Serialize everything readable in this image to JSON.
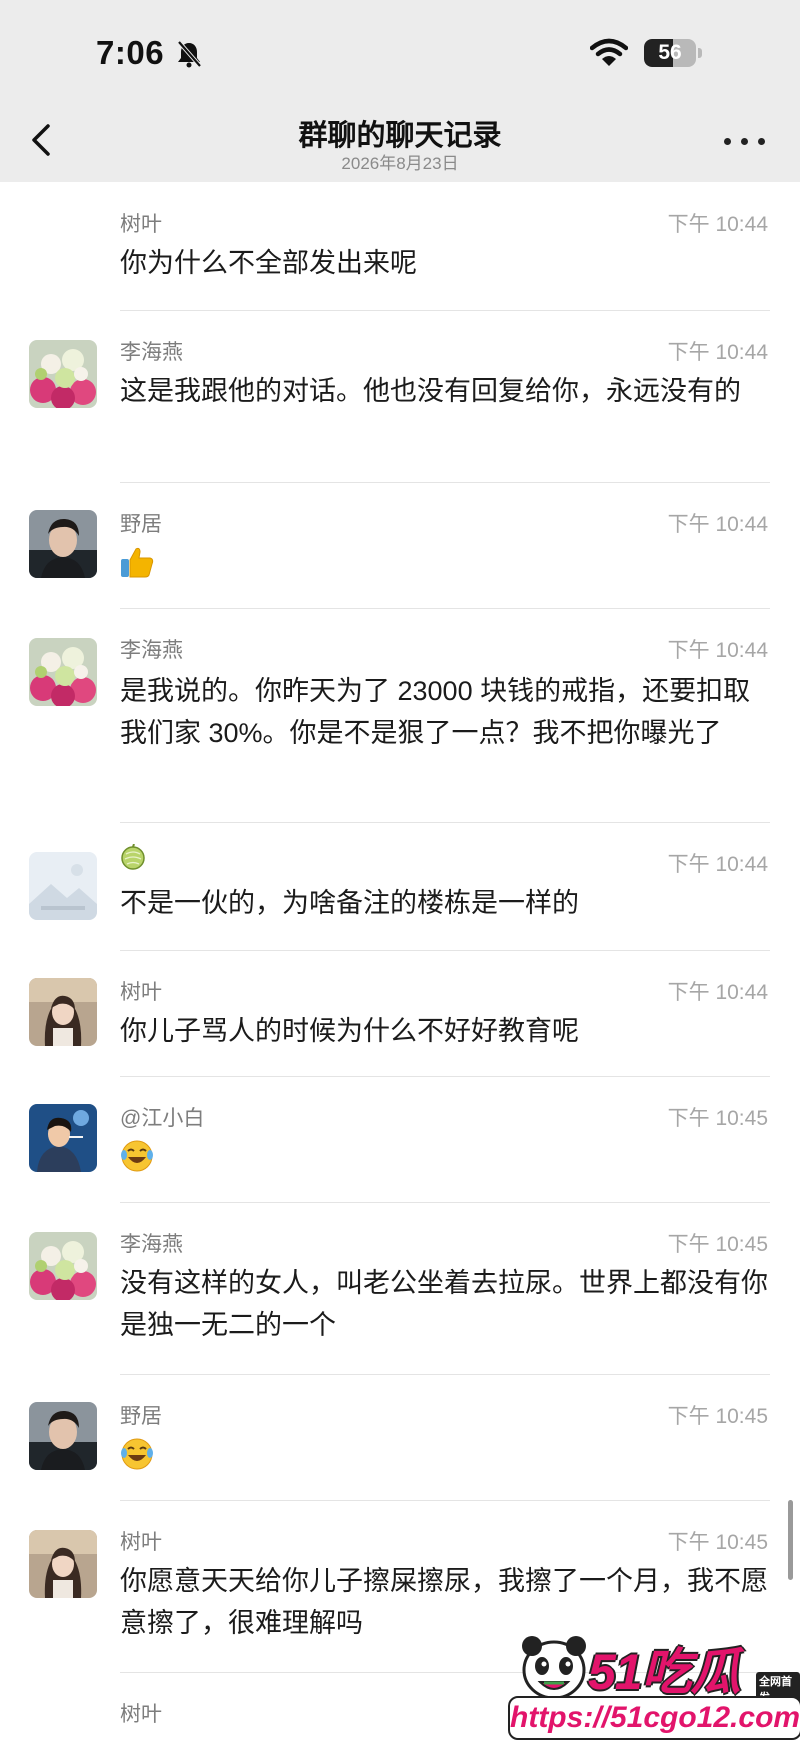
{
  "status_bar": {
    "time": "7:06",
    "battery": "56",
    "battery_level": 0.56
  },
  "header": {
    "back_icon": "chevron-left-icon",
    "title": "群聊的聊天记录",
    "date": "2026年8月23日",
    "more_icon": "more-dots-icon"
  },
  "messages": [
    {
      "sender": "树叶",
      "time": "下午 10:44",
      "text": "你为什么不全部发出来呢"
    },
    {
      "sender": "李海燕",
      "time": "下午 10:44",
      "text": "这是我跟他的对话。他也没有回复给你，永远没有的"
    },
    {
      "sender": "野居",
      "time": "下午 10:44",
      "emoji": "thumbs-up-icon"
    },
    {
      "sender": "李海燕",
      "time": "下午 10:44",
      "text": "是我说的。你昨天为了 23000 块钱的戒指，还要扣取我们家 30%。你是不是狠了一点？我不把你曝光了"
    },
    {
      "sender_emoji": "melon-icon",
      "time": "下午 10:44",
      "text": "不是一伙的，为啥备注的楼栋是一样的"
    },
    {
      "sender": "树叶",
      "time": "下午 10:44",
      "text": "你儿子骂人的时候为什么不好好教育呢"
    },
    {
      "sender": "@江小白",
      "time": "下午 10:45",
      "emoji": "laughing-tears-icon"
    },
    {
      "sender": "李海燕",
      "time": "下午 10:45",
      "text": "没有这样的女人，叫老公坐着去拉尿。世界上都没有你是独一无二的一个"
    },
    {
      "sender": "野居",
      "time": "下午 10:45",
      "emoji": "laughing-tears-icon"
    },
    {
      "sender": "树叶",
      "time": "下午 10:45",
      "text": "你愿意天天给你儿子擦屎擦尿，我擦了一个月，我不愿意擦了，很难理解吗"
    },
    {
      "sender": "树叶"
    }
  ],
  "watermark": {
    "brand": "51吃瓜",
    "tag": "全网首发",
    "url": "https://51cgo12.com"
  },
  "colors": {
    "header_bg": "#ececec",
    "sender_text": "#7d7d7d",
    "time_text": "#a6a6a6",
    "watermark_accent": "#e2146b"
  }
}
